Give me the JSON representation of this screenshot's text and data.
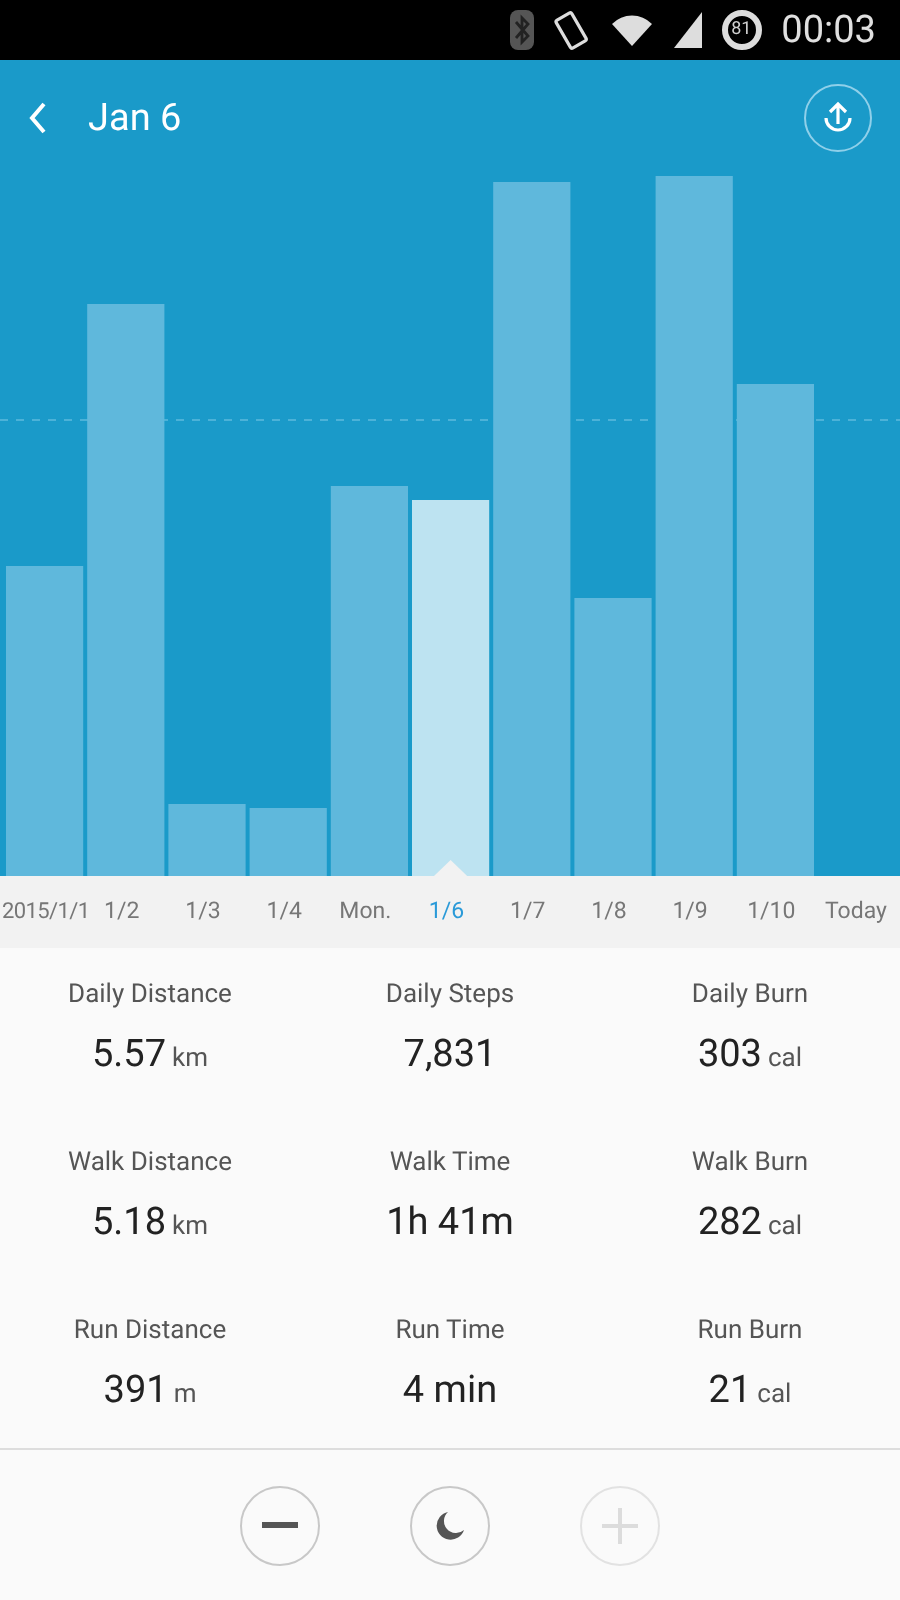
{
  "status_bar": {
    "battery": "81",
    "time": "00:03"
  },
  "header": {
    "title": "Jan 6"
  },
  "chart": {
    "axis_labels": [
      {
        "label": "2015/1/1",
        "selected": false
      },
      {
        "label": "1/2",
        "selected": false
      },
      {
        "label": "1/3",
        "selected": false
      },
      {
        "label": "1/4",
        "selected": false
      },
      {
        "label": "Mon.",
        "selected": false
      },
      {
        "label": "1/6",
        "selected": true
      },
      {
        "label": "1/7",
        "selected": false
      },
      {
        "label": "1/8",
        "selected": false
      },
      {
        "label": "1/9",
        "selected": false
      },
      {
        "label": "1/10",
        "selected": false
      },
      {
        "label": "Today",
        "selected": false
      }
    ]
  },
  "stats": [
    {
      "label": "Daily Distance",
      "value": "5.57",
      "unit": "km"
    },
    {
      "label": "Daily Steps",
      "value": "7,831"
    },
    {
      "label": "Daily Burn",
      "value": "303",
      "unit": "cal"
    },
    {
      "label": "Walk Distance",
      "value": "5.18",
      "unit": "km"
    },
    {
      "label": "Walk Time",
      "value": "1h 41m"
    },
    {
      "label": "Walk Burn",
      "value": "282",
      "unit": "cal"
    },
    {
      "label": "Run Distance",
      "value": "391",
      "unit": "m"
    },
    {
      "label": "Run Time",
      "value": "4 min"
    },
    {
      "label": "Run Burn",
      "value": "21",
      "unit": "cal"
    }
  ],
  "controls": [
    {
      "kind": "minus",
      "disabled": false
    },
    {
      "kind": "sleep",
      "disabled": false
    },
    {
      "kind": "plus",
      "disabled": true
    }
  ]
}
